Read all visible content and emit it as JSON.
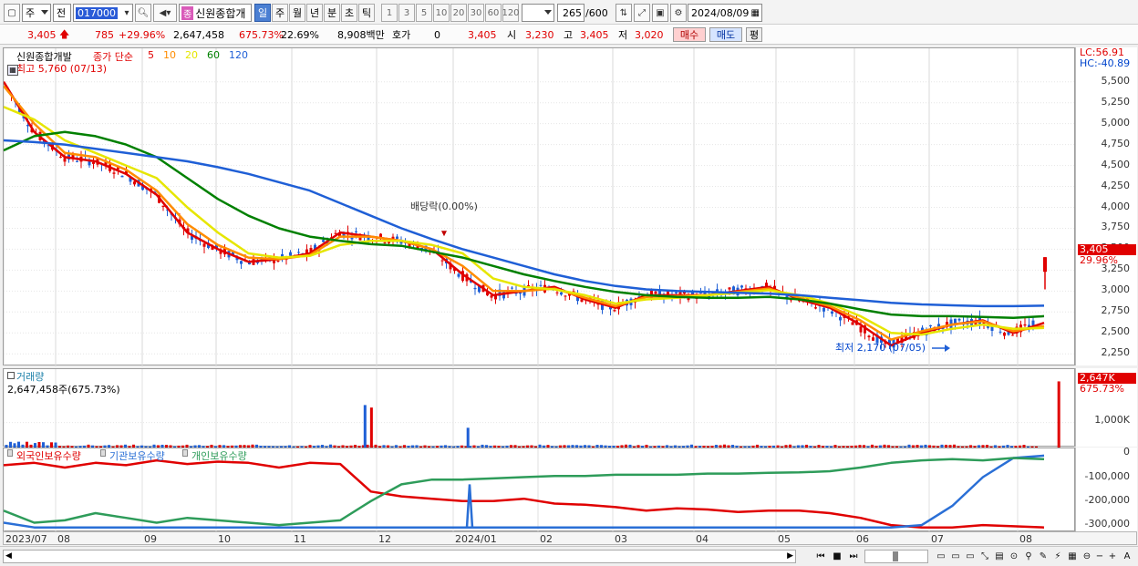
{
  "toolbar": {
    "market_type": "주",
    "compare": "전",
    "stock_code": "017000",
    "stock_tag": "종",
    "stock_name": "신원종합개",
    "periods": [
      {
        "label": "일",
        "active": true
      },
      {
        "label": "주",
        "active": false
      },
      {
        "label": "월",
        "active": false
      },
      {
        "label": "년",
        "active": false
      },
      {
        "label": "분",
        "active": false
      },
      {
        "label": "초",
        "active": false
      },
      {
        "label": "틱",
        "active": false
      }
    ],
    "intervals": [
      "1",
      "3",
      "5",
      "10",
      "20",
      "30",
      "60",
      "120"
    ],
    "count": "265",
    "count_total": "/600",
    "date": "2024/08/09"
  },
  "quote": {
    "price": "3,405",
    "change": "785",
    "change_pct": "+29.96%",
    "volume": "2,647,458",
    "volume_ratio": "675.73%",
    "turnover": "22.69%",
    "amount": "8,908백만",
    "hoga_label": "호가",
    "hoga_value": "0",
    "hoga_price": "3,405",
    "open_label": "시",
    "open": "3,230",
    "high_label": "고",
    "high": "3,405",
    "low_label": "저",
    "low": "3,020",
    "buy_label": "매수",
    "sell_label": "매도",
    "eval_label": "평"
  },
  "price_panel": {
    "title": "신원종합개발",
    "ma_label": "종가 단순",
    "ma_periods": [
      {
        "label": "5",
        "color": "#e00000"
      },
      {
        "label": "10",
        "color": "#ff8c00"
      },
      {
        "label": "20",
        "color": "#e6e600"
      },
      {
        "label": "60",
        "color": "#008000"
      },
      {
        "label": "120",
        "color": "#1f5fd6"
      }
    ],
    "high_note": "최고 5,760 (07/13)",
    "low_note": "최저 2,170 (07/05)",
    "dividend_note": "배당락(0.00%)",
    "lc": "LC:56.91",
    "hc": "HC:-40.89",
    "price_tag": "3,405",
    "price_tag_pct": "29.96%"
  },
  "volume_panel": {
    "title": "거래량",
    "value": "2,647,458주(675.73%)",
    "tag": "2,647K",
    "tag_pct": "675.73%",
    "axis_label": "1,000K"
  },
  "holding_panel": {
    "legend": [
      {
        "label": "외국인보유수량",
        "color": "#e00000"
      },
      {
        "label": "기관보유수량",
        "color": "#2a6fd6"
      },
      {
        "label": "개인보유수량",
        "color": "#2e9c5a"
      }
    ]
  },
  "chart_data": [
    {
      "type": "line",
      "title": "신원종합개발",
      "x": [
        "2023/07",
        "08",
        "09",
        "10",
        "11",
        "12",
        "2024/01",
        "02",
        "03",
        "04",
        "05",
        "06",
        "07",
        "08"
      ],
      "ylim": [
        2100,
        5900
      ],
      "yticks": [
        "5,500",
        "5,250",
        "5,000",
        "4,750",
        "4,500",
        "4,250",
        "4,000",
        "3,750",
        "3,500",
        "3,250",
        "3,000",
        "2,750",
        "2,500",
        "2,250"
      ],
      "series": [
        {
          "name": "5",
          "color": "#e00000",
          "values": [
            5500,
            4900,
            4600,
            4550,
            4400,
            4150,
            3700,
            3500,
            3350,
            3380,
            3450,
            3700,
            3650,
            3600,
            3500,
            3200,
            2950,
            3000,
            3050,
            2900,
            2800,
            2950,
            2950,
            2950,
            3000,
            3050,
            2900,
            2800,
            2600,
            2350,
            2500,
            2600,
            2650,
            2500,
            2620
          ]
        },
        {
          "name": "10",
          "color": "#ff8c00",
          "values": [
            5450,
            5000,
            4650,
            4600,
            4450,
            4200,
            3800,
            3550,
            3400,
            3380,
            3430,
            3650,
            3650,
            3600,
            3500,
            3300,
            3000,
            3000,
            3030,
            2920,
            2820,
            2930,
            2940,
            2950,
            2990,
            3030,
            2920,
            2820,
            2650,
            2420,
            2520,
            2600,
            2640,
            2520,
            2580
          ]
        },
        {
          "name": "20",
          "color": "#e6e600",
          "values": [
            5200,
            5050,
            4800,
            4650,
            4500,
            4350,
            4000,
            3700,
            3450,
            3400,
            3420,
            3550,
            3600,
            3600,
            3550,
            3450,
            3150,
            3050,
            3020,
            2950,
            2850,
            2900,
            2920,
            2950,
            2980,
            3010,
            2950,
            2850,
            2700,
            2500,
            2480,
            2550,
            2600,
            2550,
            2560
          ]
        },
        {
          "name": "60",
          "color": "#008000",
          "values": [
            4680,
            4850,
            4900,
            4850,
            4750,
            4600,
            4350,
            4100,
            3900,
            3750,
            3650,
            3600,
            3560,
            3540,
            3470,
            3400,
            3300,
            3200,
            3120,
            3050,
            2990,
            2950,
            2930,
            2920,
            2920,
            2930,
            2900,
            2850,
            2780,
            2720,
            2700,
            2700,
            2690,
            2680,
            2700
          ]
        },
        {
          "name": "120",
          "color": "#1f5fd6",
          "values": [
            4800,
            4780,
            4750,
            4700,
            4650,
            4600,
            4550,
            4480,
            4400,
            4300,
            4200,
            4050,
            3900,
            3750,
            3620,
            3500,
            3400,
            3300,
            3200,
            3120,
            3060,
            3020,
            3000,
            2990,
            2980,
            2970,
            2950,
            2920,
            2890,
            2860,
            2840,
            2830,
            2820,
            2820,
            2825
          ]
        }
      ]
    },
    {
      "type": "bar",
      "title": "거래량",
      "ylim": [
        0,
        2700000
      ],
      "yticks": [
        "1,000K"
      ],
      "spikes": [
        {
          "position": 0.337,
          "value": 1700000,
          "color": "#1f5fd6"
        },
        {
          "position": 0.343,
          "value": 1600000,
          "color": "#e00000"
        },
        {
          "position": 0.433,
          "value": 790000,
          "color": "#1f5fd6"
        },
        {
          "position": 0.984,
          "value": 2647458,
          "color": "#e00000"
        }
      ]
    },
    {
      "type": "line",
      "title": "보유수량",
      "ylim": [
        -330000,
        20000
      ],
      "yticks": [
        "0",
        "-100,000",
        "-200,000",
        "-300,000"
      ],
      "series": [
        {
          "name": "외국인보유수량",
          "color": "#e00000",
          "values": [
            -50000,
            -40000,
            -60000,
            -40000,
            -50000,
            -30000,
            -45000,
            -35000,
            -40000,
            -60000,
            -40000,
            -45000,
            -160000,
            -180000,
            -190000,
            -200000,
            -200000,
            -190000,
            -210000,
            -215000,
            -225000,
            -240000,
            -230000,
            -235000,
            -245000,
            -240000,
            -240000,
            -250000,
            -270000,
            -300000,
            -310000,
            -310000,
            -300000,
            -305000,
            -310000
          ]
        },
        {
          "name": "기관보유수량",
          "color": "#2a6fd6",
          "values": [
            -290000,
            -310000,
            -310000,
            -310000,
            -310000,
            -310000,
            -310000,
            -310000,
            -310000,
            -310000,
            -310000,
            -310000,
            -310000,
            -310000,
            -310000,
            -310000,
            -310000,
            -310000,
            -310000,
            -310000,
            -310000,
            -310000,
            -310000,
            -310000,
            -310000,
            -310000,
            -310000,
            -310000,
            -310000,
            -310000,
            -300000,
            -220000,
            -100000,
            -20000,
            -10000
          ]
        },
        {
          "name": "개인보유수량",
          "color": "#2e9c5a",
          "values": [
            -240000,
            -290000,
            -280000,
            -250000,
            -270000,
            -290000,
            -270000,
            -280000,
            -290000,
            -300000,
            -290000,
            -280000,
            -200000,
            -130000,
            -110000,
            -110000,
            -105000,
            -100000,
            -95000,
            -95000,
            -90000,
            -90000,
            -90000,
            -85000,
            -85000,
            -82000,
            -80000,
            -75000,
            -60000,
            -40000,
            -30000,
            -25000,
            -30000,
            -20000,
            -25000
          ]
        }
      ]
    }
  ]
}
